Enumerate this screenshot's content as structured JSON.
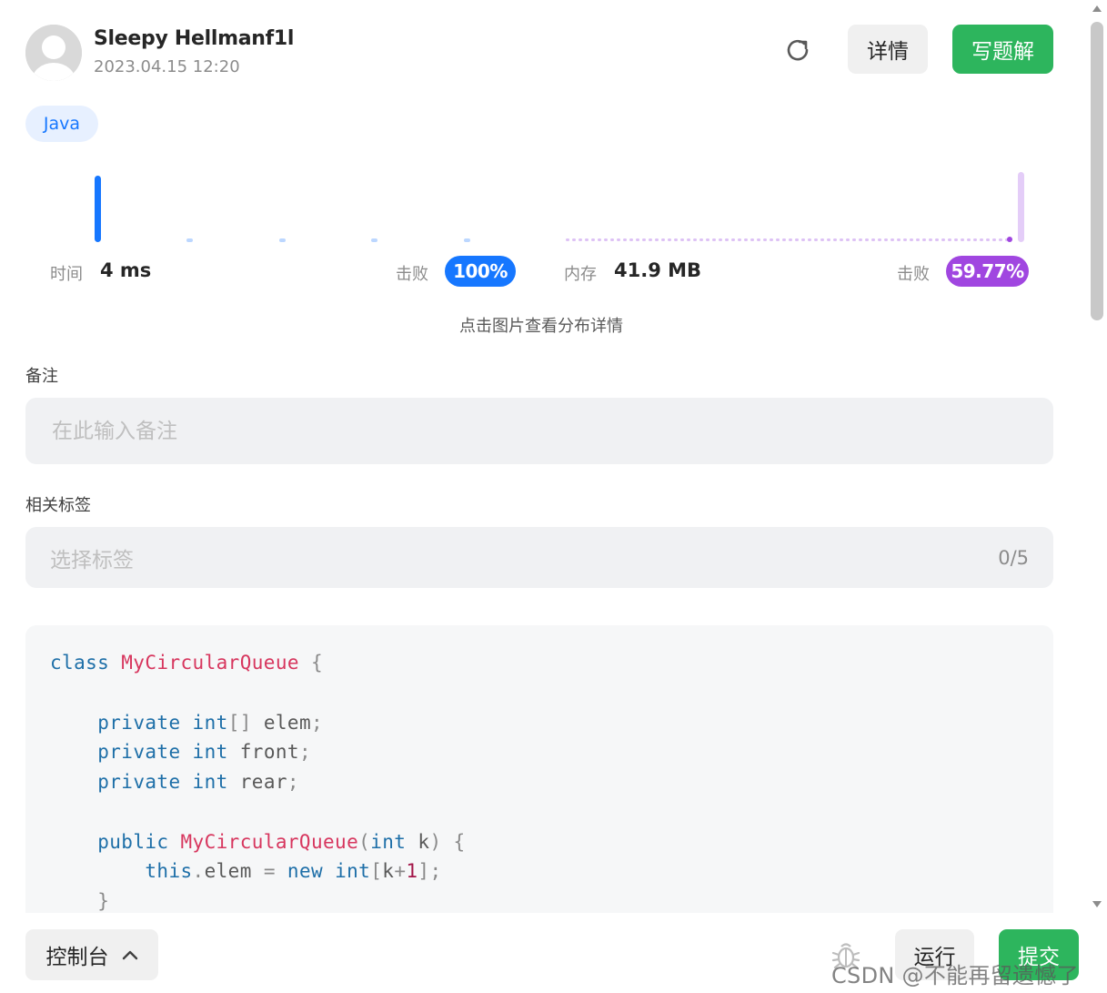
{
  "header": {
    "username": "Sleepy Hellmanf1l",
    "timestamp": "2023.04.15 12:20",
    "detail_label": "详情",
    "write_solution_label": "写题解"
  },
  "language_tag": "Java",
  "runtime": {
    "label": "时间",
    "value": "4 ms",
    "beat_label": "击败",
    "beat_value": "100%",
    "color": "#1677ff"
  },
  "memory": {
    "label": "内存",
    "value": "41.9 MB",
    "beat_label": "击败",
    "beat_value": "59.77%",
    "color": "#a046e0"
  },
  "distribution_hint": "点击图片查看分布详情",
  "notes": {
    "label": "备注",
    "placeholder": "在此输入备注",
    "value": ""
  },
  "tags": {
    "label": "相关标签",
    "placeholder": "选择标签",
    "count": "0/5"
  },
  "code": {
    "language": "java",
    "lines": [
      "class MyCircularQueue {",
      "",
      "    private int[] elem;",
      "    private int front;",
      "    private int rear;",
      "",
      "    public MyCircularQueue(int k) {",
      "        this.elem = new int[k+1];",
      "    }"
    ]
  },
  "bottom_bar": {
    "console_label": "控制台",
    "run_label": "运行",
    "submit_label": "提交"
  },
  "watermark": "CSDN @不能再留遗憾了",
  "colors": {
    "brand_green": "#2db55d",
    "runtime_blue": "#1677ff",
    "memory_purple": "#a046e0"
  }
}
